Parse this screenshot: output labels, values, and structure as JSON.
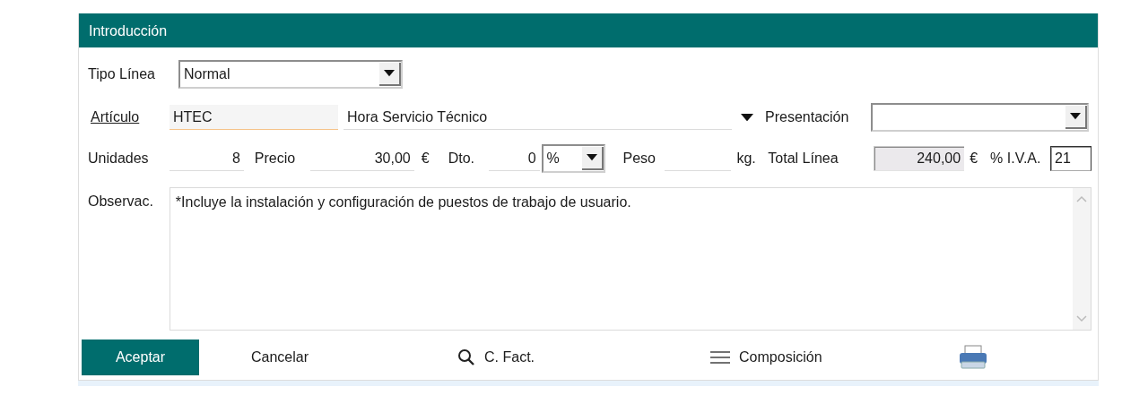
{
  "dialog": {
    "title": "Introducción"
  },
  "tipo_linea": {
    "label": "Tipo Línea",
    "value": "Normal"
  },
  "articulo": {
    "label": "Artículo",
    "code": "HTEC",
    "description": "Hora Servicio Técnico",
    "focused": true
  },
  "presentacion": {
    "label": "Presentación"
  },
  "unidades": {
    "label": "Unidades",
    "value": "8"
  },
  "precio": {
    "label": "Precio",
    "value": "30,00",
    "currency": "€"
  },
  "dto": {
    "label": "Dto.",
    "value": "0",
    "unit": "%"
  },
  "peso": {
    "label": "Peso",
    "unit": "kg."
  },
  "total_linea": {
    "label": "Total Línea",
    "value": "240,00",
    "currency": "€",
    "disabled": true
  },
  "iva": {
    "label": "% I.V.A.",
    "value": "21"
  },
  "observaciones": {
    "label": "Observac.",
    "value": "*Incluye la instalación y configuración de puestos de trabajo de usuario."
  },
  "buttons": [
    {
      "kind": "primary",
      "label": "Aceptar"
    },
    {
      "kind": "plain",
      "label": "Cancelar"
    },
    {
      "kind": "search",
      "label": "C. Fact."
    },
    {
      "kind": "list",
      "label": "Composición"
    },
    {
      "kind": "print"
    }
  ]
}
